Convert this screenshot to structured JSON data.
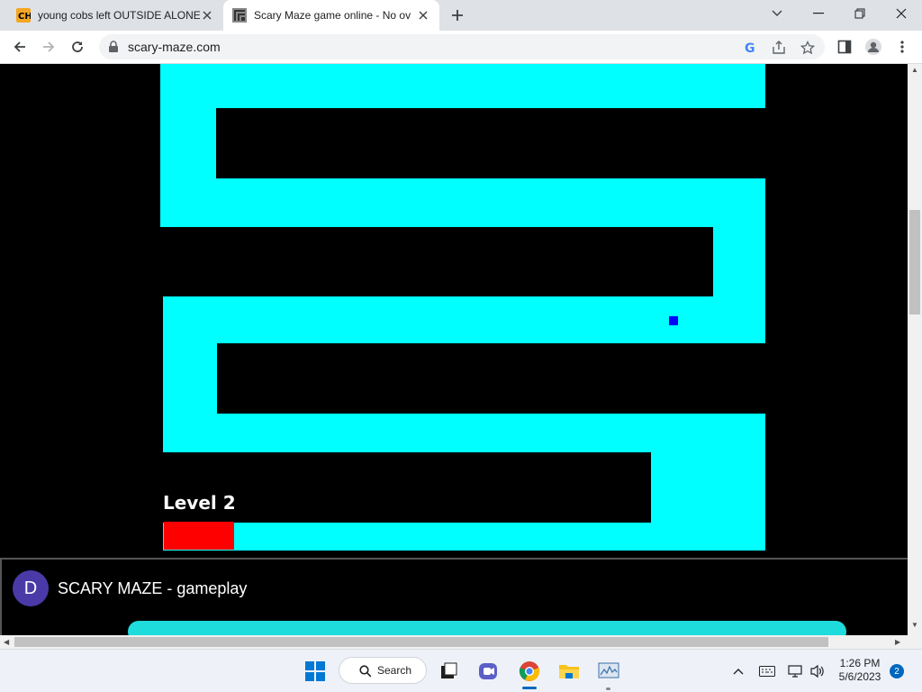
{
  "tabs": [
    {
      "title": "young cobs left OUTSIDE ALONE",
      "favicon": "ch-icon",
      "active": false
    },
    {
      "title": "Scary Maze game online - No ov",
      "favicon": "maze-icon",
      "active": true
    }
  ],
  "toolbar": {
    "url": "scary-maze.com"
  },
  "game": {
    "level_text": "Level 2",
    "colors": {
      "path": "#00ffff",
      "wall": "#000000",
      "start": "#ff0000",
      "player": "#0000ff"
    }
  },
  "video": {
    "avatar_letter": "D",
    "title": "SCARY MAZE - gameplay"
  },
  "taskbar": {
    "search_label": "Search",
    "time": "1:26 PM",
    "date": "5/6/2023",
    "notifications": "2"
  }
}
